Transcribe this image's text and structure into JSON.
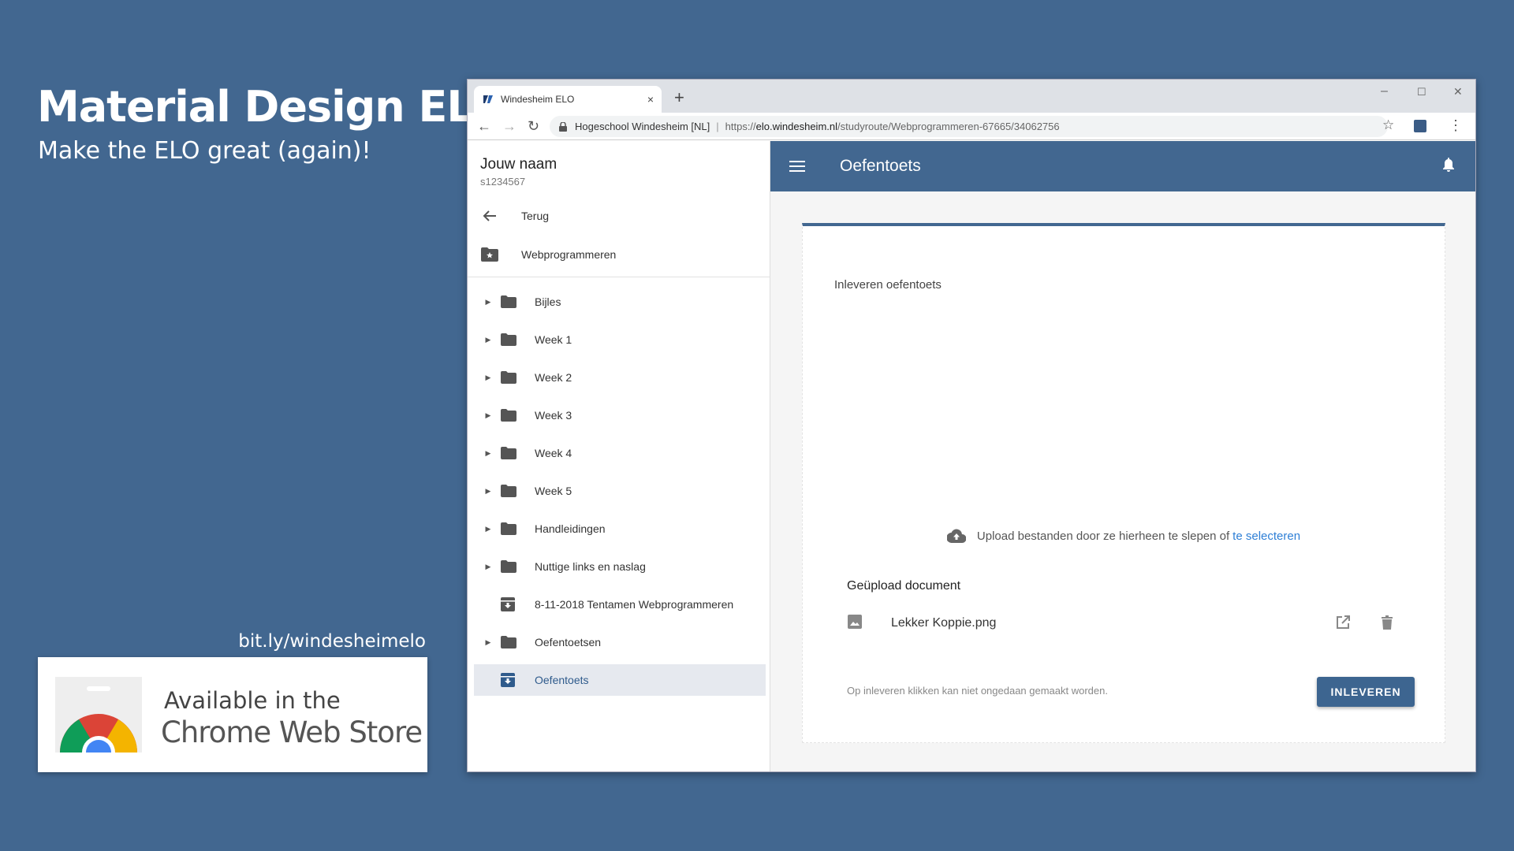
{
  "promo": {
    "title": "Material Design ELO",
    "subtitle": "Make the ELO great (again)!",
    "link": "bit.ly/windesheimelo",
    "store_line1": "Available in the",
    "store_line2": "Chrome Web Store"
  },
  "browser": {
    "tab_title": "Windesheim ELO",
    "tab_close": "×",
    "new_tab": "+",
    "site_name": "Hogeschool Windesheim [NL]",
    "url_scheme": "https://",
    "url_host": "elo.windesheim.nl",
    "url_path": "/studyroute/Webprogrammeren-67665/34062756",
    "min": "–",
    "max": "☐",
    "close": "✕",
    "back": "←",
    "forward": "→",
    "reload": "↻",
    "star": "☆",
    "menu": "⋮"
  },
  "drawer": {
    "user_name": "Jouw naam",
    "user_id": "s1234567",
    "back_label": "Terug",
    "course_label": "Webprogrammeren",
    "items": [
      {
        "label": "Bijles",
        "icon": "folder-icon"
      },
      {
        "label": "Week 1",
        "icon": "folder-icon"
      },
      {
        "label": "Week 2",
        "icon": "folder-icon"
      },
      {
        "label": "Week 3",
        "icon": "folder-icon"
      },
      {
        "label": "Week 4",
        "icon": "folder-icon"
      },
      {
        "label": "Week 5",
        "icon": "folder-icon"
      },
      {
        "label": "Handleidingen",
        "icon": "folder-icon"
      },
      {
        "label": "Nuttige links en naslag",
        "icon": "folder-icon"
      },
      {
        "label": "8-11-2018 Tentamen Webprogrammeren",
        "icon": "archive-icon"
      },
      {
        "label": "Oefentoetsen",
        "icon": "folder-icon"
      },
      {
        "label": "Oefentoets",
        "icon": "archive-icon",
        "active": true
      }
    ]
  },
  "appbar": {
    "title": "Oefentoets"
  },
  "card": {
    "heading": "Inleveren oefentoets",
    "upload_text": "Upload bestanden door ze hierheen te slepen of",
    "upload_link": "te selecteren",
    "uploaded_title": "Geüpload document",
    "file_name": "Lekker Koppie.png",
    "note": "Op inleveren klikken kan niet ongedaan gemaakt worden.",
    "submit_label": "INLEVEREN"
  },
  "colors": {
    "background": "#426790",
    "appbar": "#426790",
    "button": "#3d6590",
    "link": "#2e7fd6",
    "active_item_bg": "#e6e9ef"
  }
}
